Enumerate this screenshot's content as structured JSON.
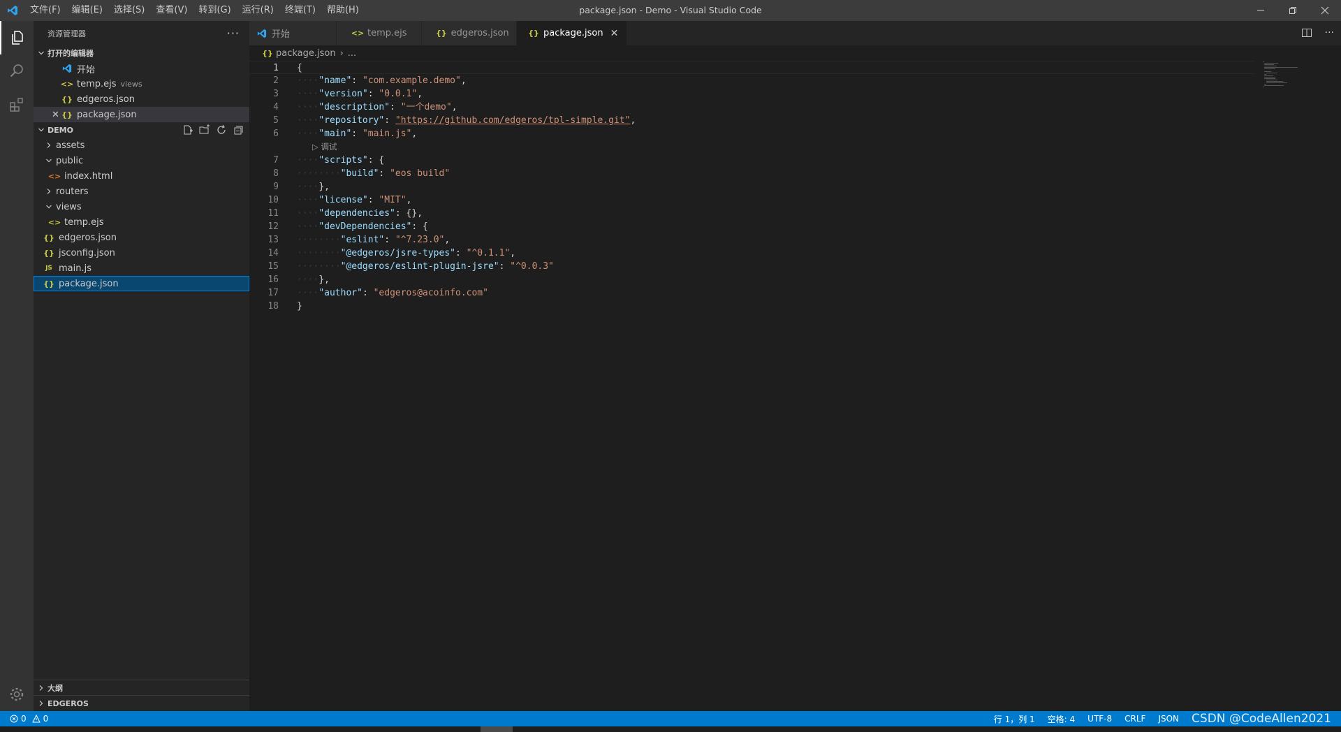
{
  "window": {
    "title": "package.json - Demo - Visual Studio Code"
  },
  "menu": [
    "文件(F)",
    "编辑(E)",
    "选择(S)",
    "查看(V)",
    "转到(G)",
    "运行(R)",
    "终端(T)",
    "帮助(H)"
  ],
  "sidebar": {
    "title": "资源管理器",
    "more": "···",
    "open_editors": {
      "header": "打开的编辑器",
      "items": [
        {
          "label": "开始",
          "desc": ""
        },
        {
          "label": "temp.ejs",
          "desc": "views"
        },
        {
          "label": "edgeros.json",
          "desc": ""
        },
        {
          "label": "package.json",
          "desc": ""
        }
      ]
    },
    "folder": {
      "header": "DEMO",
      "tree": [
        {
          "label": "assets"
        },
        {
          "label": "public"
        },
        {
          "label": "index.html"
        },
        {
          "label": "routers"
        },
        {
          "label": "views"
        },
        {
          "label": "temp.ejs"
        },
        {
          "label": "edgeros.json"
        },
        {
          "label": "jsconfig.json"
        },
        {
          "label": "main.js"
        },
        {
          "label": "package.json"
        }
      ]
    },
    "outline": {
      "header": "大纲"
    },
    "edgeros": {
      "header": "EDGEROS"
    }
  },
  "tabs": [
    {
      "label": "开始"
    },
    {
      "label": "temp.ejs"
    },
    {
      "label": "edgeros.json"
    },
    {
      "label": "package.json"
    }
  ],
  "breadcrumb": {
    "file": "package.json",
    "sep": "›",
    "rest": "..."
  },
  "editor": {
    "codelens": "调试",
    "lines": [
      {
        "n": "1",
        "p": "{"
      },
      {
        "n": "2",
        "k": "\"name\"",
        "v": "\"com.example.demo\"",
        "e": ","
      },
      {
        "n": "3",
        "k": "\"version\"",
        "v": "\"0.0.1\"",
        "e": ","
      },
      {
        "n": "4",
        "k": "\"description\"",
        "v": "\"一个demo\"",
        "e": ","
      },
      {
        "n": "5",
        "k": "\"repository\"",
        "v": "\"https://github.com/edgeros/tpl-simple.git\"",
        "e": ","
      },
      {
        "n": "6",
        "k": "\"main\"",
        "v": "\"main.js\"",
        "e": ","
      },
      {
        "n": "7",
        "k": "\"scripts\"",
        "e": ": {"
      },
      {
        "n": "8",
        "k": "\"build\"",
        "v": "\"eos build\"",
        "e": ""
      },
      {
        "n": "9",
        "p": "},"
      },
      {
        "n": "10",
        "k": "\"license\"",
        "v": "\"MIT\"",
        "e": ","
      },
      {
        "n": "11",
        "k": "\"dependencies\"",
        "e": ": {},"
      },
      {
        "n": "12",
        "k": "\"devDependencies\"",
        "e": ": {"
      },
      {
        "n": "13",
        "k": "\"eslint\"",
        "v": "\"^7.23.0\"",
        "e": ","
      },
      {
        "n": "14",
        "k": "\"@edgeros/jsre-types\"",
        "v": "\"^0.1.1\"",
        "e": ","
      },
      {
        "n": "15",
        "k": "\"@edgeros/eslint-plugin-jsre\"",
        "v": "\"^0.0.3\"",
        "e": ""
      },
      {
        "n": "16",
        "p": "},"
      },
      {
        "n": "17",
        "k": "\"author\"",
        "v": "\"edgeros@acoinfo.com\"",
        "e": ""
      },
      {
        "n": "18",
        "p": "}"
      }
    ]
  },
  "statusbar": {
    "errors": "0",
    "warnings": "0",
    "position": "行 1，列 1",
    "spaces": "空格: 4",
    "encoding": "UTF-8",
    "eol": "CRLF",
    "language": "JSON",
    "watermark": "CSDN @CodeAllen2021"
  },
  "colors": {
    "accent": "#007acc",
    "key": "#9cdcfe",
    "string": "#ce9178",
    "json_icon": "#cbcb41"
  }
}
